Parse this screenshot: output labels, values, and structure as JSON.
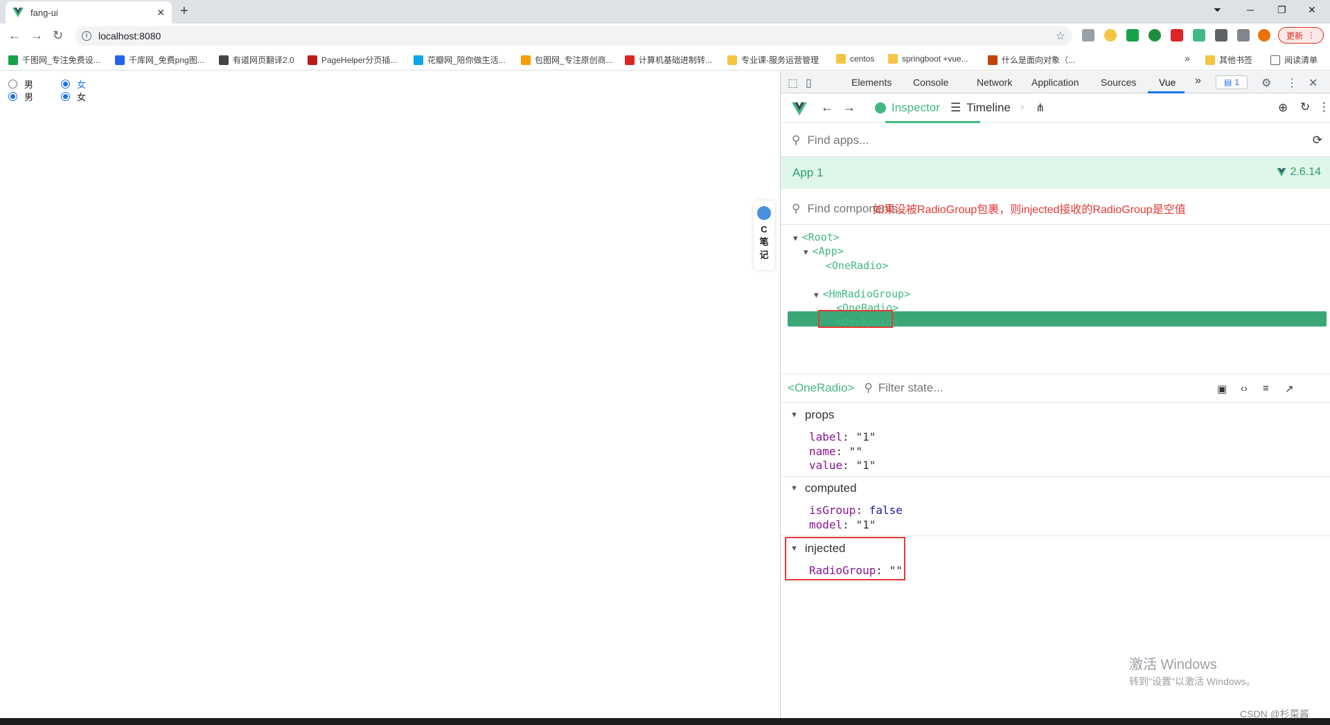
{
  "browser": {
    "tab_title": "fang-ui",
    "new_tab_symbol": "+",
    "close_symbol": "✕",
    "url": "localhost:8080",
    "update_label": "更新",
    "bookmarks": [
      {
        "label": "千图网_专注免费设...",
        "color": "#16a34a"
      },
      {
        "label": "千库网_免费png图...",
        "color": "#2563eb"
      },
      {
        "label": "有道网页翻译2.0",
        "color": "#444444"
      },
      {
        "label": "PageHelper分页插...",
        "color": "#b91c1c"
      },
      {
        "label": "花瓣网_陪你做生活...",
        "color": "#0ea5e9"
      },
      {
        "label": "包图网_专注原创商...",
        "color": "#f59e0b"
      },
      {
        "label": "计算机基础进制转...",
        "color": "#dc2626"
      },
      {
        "label": "专业课-服务运营管理",
        "color": "#f5c542"
      },
      {
        "label": "centos",
        "color": "#f5c542"
      },
      {
        "label": "springboot +vue...",
        "color": "#f5c542"
      },
      {
        "label": "什么是面向对象（...",
        "color": "#c2410c"
      }
    ],
    "more_bookmarks_symbol": "»",
    "other_bookmarks": "其他书签",
    "reading_list": "阅读清单"
  },
  "page": {
    "rows": [
      {
        "options": [
          {
            "label": "男",
            "checked": false
          },
          {
            "label": "女",
            "checked": true
          }
        ]
      },
      {
        "options": [
          {
            "label": "男",
            "checked": true
          },
          {
            "label": "女",
            "checked": true
          }
        ]
      }
    ],
    "cnote_letter": "C",
    "cnote_text_1": "笔",
    "cnote_text_2": "记"
  },
  "devtools": {
    "tabs": [
      "Elements",
      "Console",
      "Network",
      "Application",
      "Sources",
      "Vue"
    ],
    "active_tab": "Vue",
    "more_tabs": "»",
    "issues_count": "1",
    "vue": {
      "inspector_label": "Inspector",
      "timeline_label": "Timeline",
      "find_apps_placeholder": "Find apps...",
      "app_name": "App 1",
      "vue_version": "2.6.14",
      "find_components_placeholder": "Find components...",
      "tree": [
        {
          "label": "<Root>",
          "depth": 0,
          "expanded": true
        },
        {
          "label": "<App>",
          "depth": 1,
          "expanded": true
        },
        {
          "label": "<OneRadio>",
          "depth": 2,
          "expanded": false
        },
        {
          "label": "<OneRadio>",
          "depth": 2,
          "expanded": false,
          "selected": true
        },
        {
          "label": "<HmRadioGroup>",
          "depth": 2,
          "expanded": true
        },
        {
          "label": "<OneRadio>",
          "depth": 3,
          "expanded": false
        },
        {
          "label": "<OneRadio>",
          "depth": 3,
          "expanded": false
        }
      ],
      "annotation": "如果没被RadioGroup包裹，则injected接收的RadioGroup是空值",
      "selected_component": "<OneRadio>",
      "filter_state_placeholder": "Filter state...",
      "sections": {
        "props": {
          "title": "props",
          "items": [
            {
              "key": "label",
              "value": "\"1\""
            },
            {
              "key": "name",
              "value": "\"\""
            },
            {
              "key": "value",
              "value": "\"1\""
            }
          ]
        },
        "computed": {
          "title": "computed",
          "items": [
            {
              "key": "isGroup",
              "value": "false"
            },
            {
              "key": "model",
              "value": "\"1\""
            }
          ]
        },
        "injected": {
          "title": "injected",
          "items": [
            {
              "key": "RadioGroup",
              "value": "\"\""
            }
          ]
        }
      }
    }
  },
  "watermark": {
    "line1": "激活 Windows",
    "line2": "转到\"设置\"以激活 Windows。"
  },
  "csdn_credit": "CSDN @杉菜酱_",
  "colors": {
    "vue_green": "#42b883",
    "annotation_red": "#e53935",
    "selected_row": "#3ba776"
  }
}
